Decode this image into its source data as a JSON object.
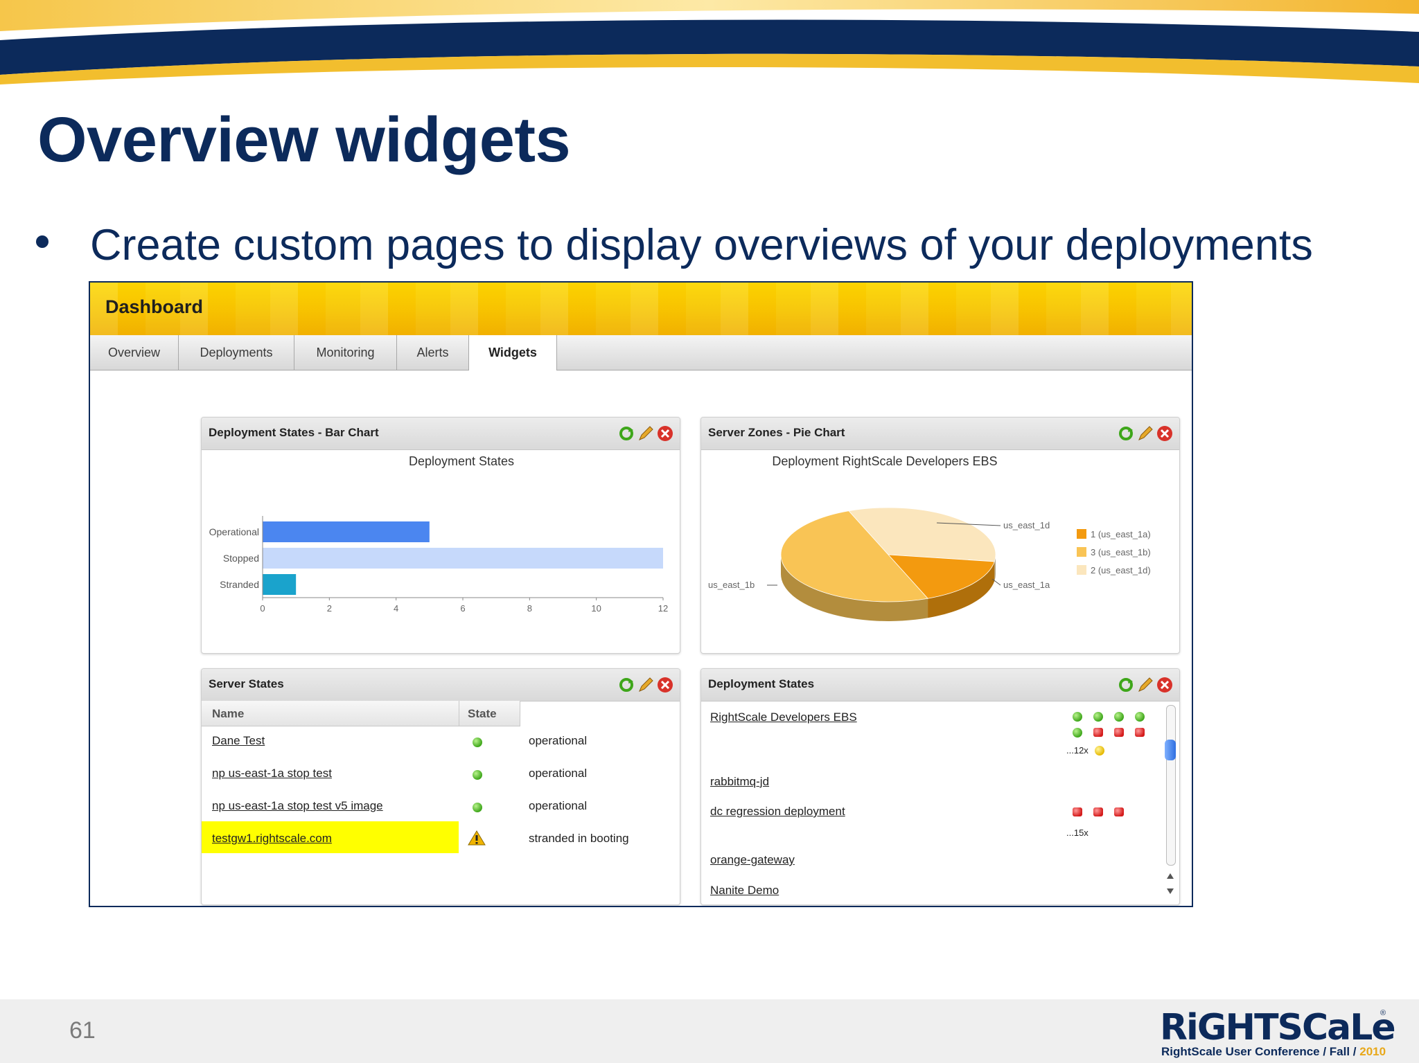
{
  "slide": {
    "title": "Overview widgets",
    "bullet": "Create custom pages to display overviews of your deployments",
    "page_number": "61",
    "logo": {
      "wordmark": "RiGHTSCaLe",
      "registered": "®",
      "subtitle_prefix": "RightScale User Conference / Fall / ",
      "subtitle_year": "2010"
    }
  },
  "dashboard": {
    "title": "Dashboard",
    "tabs": [
      {
        "label": "Overview"
      },
      {
        "label": "Deployments"
      },
      {
        "label": "Monitoring"
      },
      {
        "label": "Alerts"
      },
      {
        "label": "Widgets",
        "active": true
      }
    ],
    "widget_icons": [
      "refresh-icon",
      "edit-pencil-icon",
      "close-icon"
    ],
    "widgets": {
      "bar": {
        "title": "Deployment States - Bar Chart"
      },
      "pie": {
        "title": "Server Zones - Pie Chart"
      },
      "servers": {
        "title": "Server States",
        "columns": [
          "Name",
          "State"
        ],
        "rows": [
          {
            "name": "Dane Test",
            "status_icon": "green-dot-icon",
            "state": "operational"
          },
          {
            "name": "np us-east-1a stop test",
            "status_icon": "green-dot-icon",
            "state": "operational"
          },
          {
            "name": "np us-east-1a stop test v5 image",
            "status_icon": "green-dot-icon",
            "state": "operational"
          },
          {
            "name": "testgw1.rightscale.com",
            "status_icon": "warning-icon",
            "state": "stranded in booting",
            "highlight": "#ffff00"
          }
        ]
      },
      "deployments": {
        "title": "Deployment States",
        "items": [
          {
            "name": "RightScale Developers EBS",
            "count_label": "...12x"
          },
          {
            "name": "rabbitmq-jd"
          },
          {
            "name": "dc regression deployment",
            "count_label": "...15x"
          },
          {
            "name": "orange-gateway"
          },
          {
            "name": "Nanite Demo"
          }
        ]
      }
    }
  },
  "chart_data": [
    {
      "type": "bar",
      "orientation": "horizontal",
      "title": "Deployment States",
      "categories": [
        "Operational",
        "Stopped",
        "Stranded"
      ],
      "values": [
        5,
        12,
        1
      ],
      "colors": [
        "#4b86f0",
        "#c6d9fb",
        "#1aa3cc"
      ],
      "xlim": [
        0,
        12
      ],
      "xticks": [
        0,
        2,
        4,
        6,
        8,
        10,
        12
      ]
    },
    {
      "type": "pie",
      "title": "Deployment RightScale Developers EBS",
      "slices": [
        {
          "label": "us_east_1a",
          "value": 1,
          "color": "#f39a0f",
          "legend": "1 (us_east_1a)"
        },
        {
          "label": "us_east_1b",
          "value": 3,
          "color": "#f9c455",
          "legend": "3 (us_east_1b)"
        },
        {
          "label": "us_east_1d",
          "value": 2,
          "color": "#fbe6bd",
          "legend": "2 (us_east_1d)"
        }
      ],
      "legend_position": "right"
    }
  ]
}
